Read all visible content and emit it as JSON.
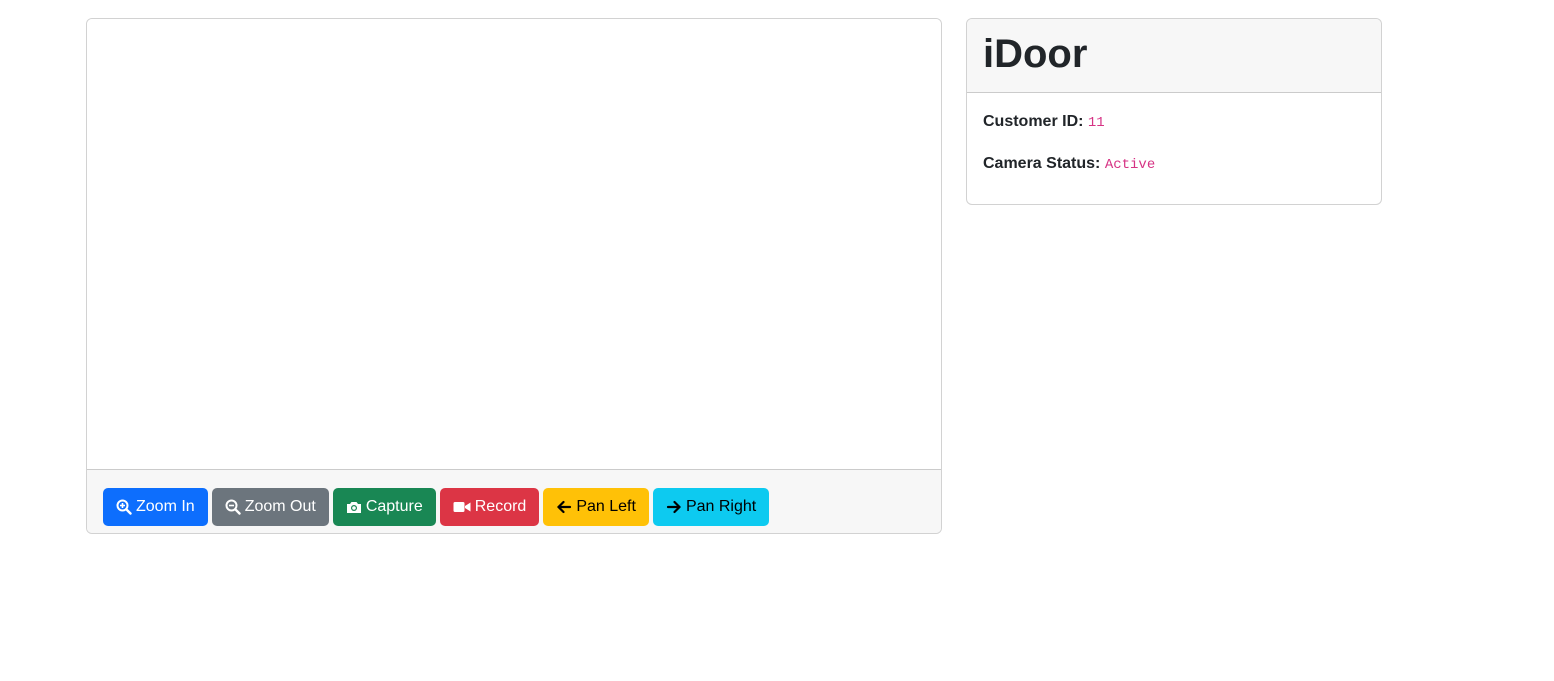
{
  "camera": {
    "buttons": [
      {
        "label": "Zoom In",
        "icon": "zoom-in-icon",
        "color": "#0d6efd"
      },
      {
        "label": "Zoom Out",
        "icon": "zoom-out-icon",
        "color": "#6c757d"
      },
      {
        "label": "Capture",
        "icon": "camera-icon",
        "color": "#198754"
      },
      {
        "label": "Record",
        "icon": "video-icon",
        "color": "#dc3545"
      },
      {
        "label": "Pan Left",
        "icon": "arrow-left-icon",
        "color": "#ffc107"
      },
      {
        "label": "Pan Right",
        "icon": "arrow-right-icon",
        "color": "#0dcaf0"
      }
    ]
  },
  "info": {
    "title": "iDoor",
    "customer_id_label": "Customer ID:",
    "customer_id_value": "11",
    "camera_status_label": "Camera Status:",
    "camera_status_value": "Active",
    "value_color": "#d63384"
  }
}
